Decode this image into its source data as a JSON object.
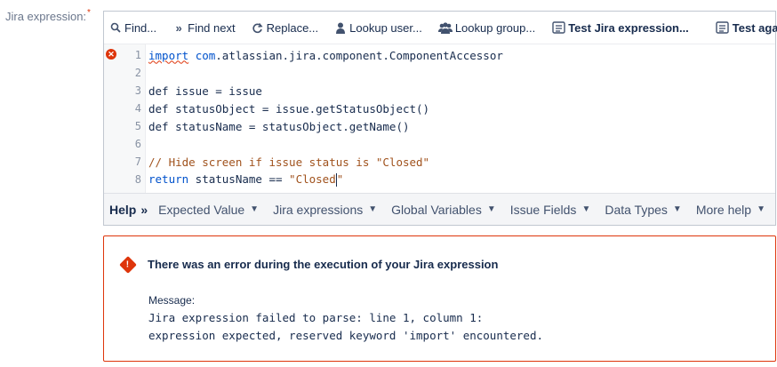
{
  "field": {
    "label": "Jira expression:",
    "required_mark": "*"
  },
  "toolbar": {
    "find": "Find...",
    "find_next": "Find next",
    "replace": "Replace...",
    "lookup_user": "Lookup user...",
    "lookup_group": "Lookup group...",
    "test_expression": "Test Jira expression...",
    "test_again": "Test again"
  },
  "editor": {
    "lines": [
      {
        "num": "1",
        "text": "import com.atlassian.jira.component.ComponentAccessor"
      },
      {
        "num": "2",
        "text": ""
      },
      {
        "num": "3",
        "text": "def issue = issue"
      },
      {
        "num": "4",
        "text": "def statusObject = issue.getStatusObject()"
      },
      {
        "num": "5",
        "text": "def statusName = statusObject.getName()"
      },
      {
        "num": "6",
        "text": ""
      },
      {
        "num": "7",
        "text": "// Hide screen if issue status is \"Closed\""
      },
      {
        "num": "8",
        "text": "return statusName == \"Closed\""
      }
    ]
  },
  "help": {
    "title": "Help",
    "chevron": "»",
    "items": [
      "Expected Value",
      "Jira expressions",
      "Global Variables",
      "Issue Fields",
      "Data Types",
      "More help"
    ]
  },
  "error": {
    "title": "There was an error during the execution of your Jira expression",
    "message_label": "Message:",
    "message_line1": "Jira expression failed to parse: line 1, column 1:",
    "message_line2": "expression expected, reserved keyword 'import' encountered."
  },
  "colors": {
    "error": "#de350b",
    "keyword": "#0052cc",
    "string": "#a0521d"
  }
}
